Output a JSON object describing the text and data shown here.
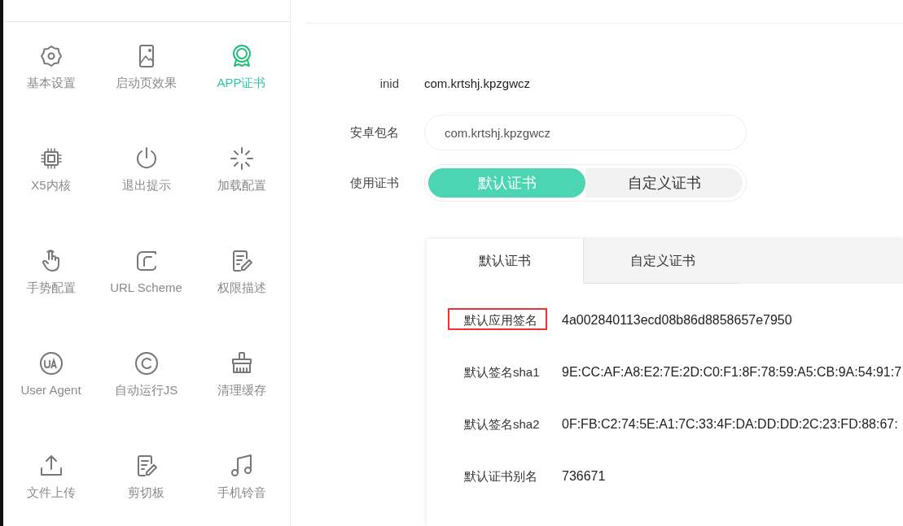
{
  "sidebar": {
    "items": [
      {
        "label": "基本设置",
        "selected": false
      },
      {
        "label": "启动页效果",
        "selected": false
      },
      {
        "label": "APP证书",
        "selected": true
      },
      {
        "label": "X5内核",
        "selected": false
      },
      {
        "label": "退出提示",
        "selected": false
      },
      {
        "label": "加载配置",
        "selected": false
      },
      {
        "label": "手势配置",
        "selected": false
      },
      {
        "label": "URL Scheme",
        "selected": false
      },
      {
        "label": "权限描述",
        "selected": false
      },
      {
        "label": "User Agent",
        "selected": false
      },
      {
        "label": "自动运行JS",
        "selected": false
      },
      {
        "label": "清理缓存",
        "selected": false
      },
      {
        "label": "文件上传",
        "selected": false
      },
      {
        "label": "剪切板",
        "selected": false
      },
      {
        "label": "手机铃音",
        "selected": false
      }
    ]
  },
  "form": {
    "inid": {
      "label": "inid",
      "value": "com.krtshj.kpzgwcz"
    },
    "package": {
      "label": "安卓包名",
      "value": "com.krtshj.kpzgwcz"
    },
    "certificate": {
      "label": "使用证书",
      "options": [
        {
          "label": "默认证书",
          "selected": true
        },
        {
          "label": "自定义证书",
          "selected": false
        }
      ]
    }
  },
  "card": {
    "tabs": [
      {
        "label": "默认证书",
        "selected": true
      },
      {
        "label": "自定义证书",
        "selected": false
      }
    ],
    "rows": [
      {
        "label": "默认应用签名",
        "value": "4a002840113ecd08b86d8858657e7950",
        "highlighted": true
      },
      {
        "label": "默认签名sha1",
        "value": "9E:CC:AF:A8:E2:7E:2D:C0:F1:8F:78:59:A5:CB:9A:54:91:7",
        "highlighted": false
      },
      {
        "label": "默认签名sha2",
        "value": "0F:FB:C2:74:5E:A1:7C:33:4F:DA:DD:DD:2C:23:FD:88:67:",
        "highlighted": false
      },
      {
        "label": "默认证书别名",
        "value": "736671",
        "highlighted": false
      }
    ]
  }
}
